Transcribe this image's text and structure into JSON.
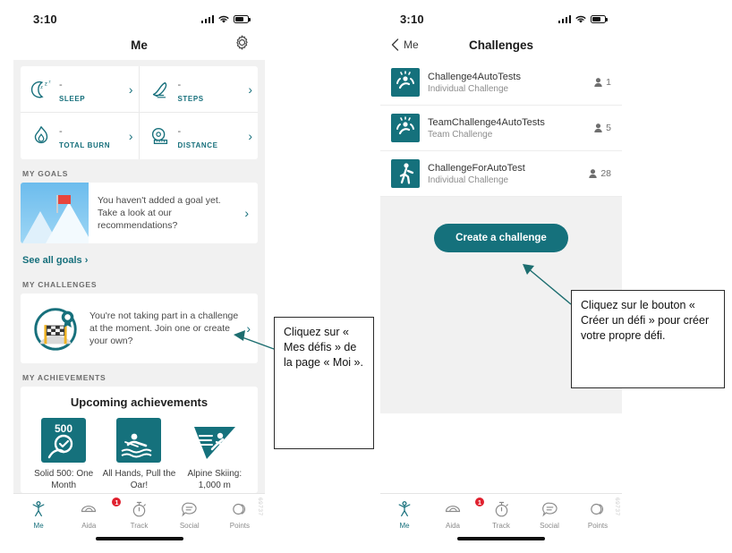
{
  "meta": {
    "accent_teal": "#15717c",
    "badge_red": "#e0202e",
    "page_bg": "#ffffff",
    "screen_bg": "#f1f1f1",
    "build_number": "69737"
  },
  "status_bar": {
    "time": "3:10",
    "icons": [
      "signal-bars-icon",
      "wifi-icon",
      "battery-icon"
    ]
  },
  "left_phone": {
    "navbar": {
      "title": "Me",
      "gear_icon": "gear-icon"
    },
    "metrics": [
      {
        "icon": "sleep-moon-icon",
        "value": "-",
        "name": "SLEEP",
        "chevron": "›"
      },
      {
        "icon": "steps-shoe-icon",
        "value": "-",
        "name": "STEPS",
        "chevron": "›"
      },
      {
        "icon": "flame-icon",
        "value": "-",
        "name": "TOTAL BURN",
        "chevron": "›"
      },
      {
        "icon": "tape-measure-icon",
        "value": "-",
        "name": "DISTANCE",
        "chevron": "›"
      }
    ],
    "goals": {
      "section_label": "MY GOALS",
      "card_text": "You haven't added a goal yet. Take a look at our recommendations?",
      "chevron": "›",
      "link": "See all goals ›",
      "image_icon": "mountain-flag-icon"
    },
    "challenges": {
      "section_label": "MY CHALLENGES",
      "card_text": "You're not taking part in a challenge at the moment. Join one or create your own?",
      "chevron": "›",
      "icon": "checkered-flag-badge-icon"
    },
    "achievements": {
      "section_label": "MY ACHIEVEMENTS",
      "card_title": "Upcoming achievements",
      "items": [
        {
          "icon": "solid-500-shield-icon",
          "badge_number": "500",
          "caption": "Solid 500: One Month"
        },
        {
          "icon": "rowing-icon",
          "badge_number": "",
          "caption": "All Hands, Pull the Oar!"
        },
        {
          "icon": "alpine-skiing-icon",
          "badge_number": "",
          "caption": "Alpine Skiing: 1,000 m"
        }
      ]
    }
  },
  "right_phone": {
    "navbar": {
      "back_label": "Me",
      "back_icon": "chevron-left-icon",
      "title": "Challenges"
    },
    "challenge_list": [
      {
        "icon": "challenge-person-icon",
        "name": "Challenge4AutoTests",
        "type": "Individual Challenge",
        "participants": "1",
        "participants_icon": "person-icon"
      },
      {
        "icon": "challenge-person-icon",
        "name": "TeamChallenge4AutoTests",
        "type": "Team Challenge",
        "participants": "5",
        "participants_icon": "person-icon"
      },
      {
        "icon": "walking-person-icon",
        "name": "ChallengeForAutoTest",
        "type": "Individual Challenge",
        "participants": "28",
        "participants_icon": "person-icon"
      }
    ],
    "cta_button": "Create a challenge"
  },
  "tab_bar": {
    "tabs": [
      {
        "label": "Me",
        "icon": "person-arms-up-icon",
        "badge": "",
        "active": true
      },
      {
        "label": "Aida",
        "icon": "aida-assistant-icon",
        "badge": "1",
        "active": false
      },
      {
        "label": "Track",
        "icon": "stopwatch-icon",
        "badge": "",
        "active": false
      },
      {
        "label": "Social",
        "icon": "chat-bubble-icon",
        "badge": "",
        "active": false
      },
      {
        "label": "Points",
        "icon": "coins-icon",
        "badge": "",
        "active": false
      }
    ]
  },
  "callouts": {
    "left": "Cliquez sur « Mes défis » de la page « Moi ».",
    "right": "Cliquez sur le bouton « Créer un défi » pour créer votre propre défi."
  }
}
